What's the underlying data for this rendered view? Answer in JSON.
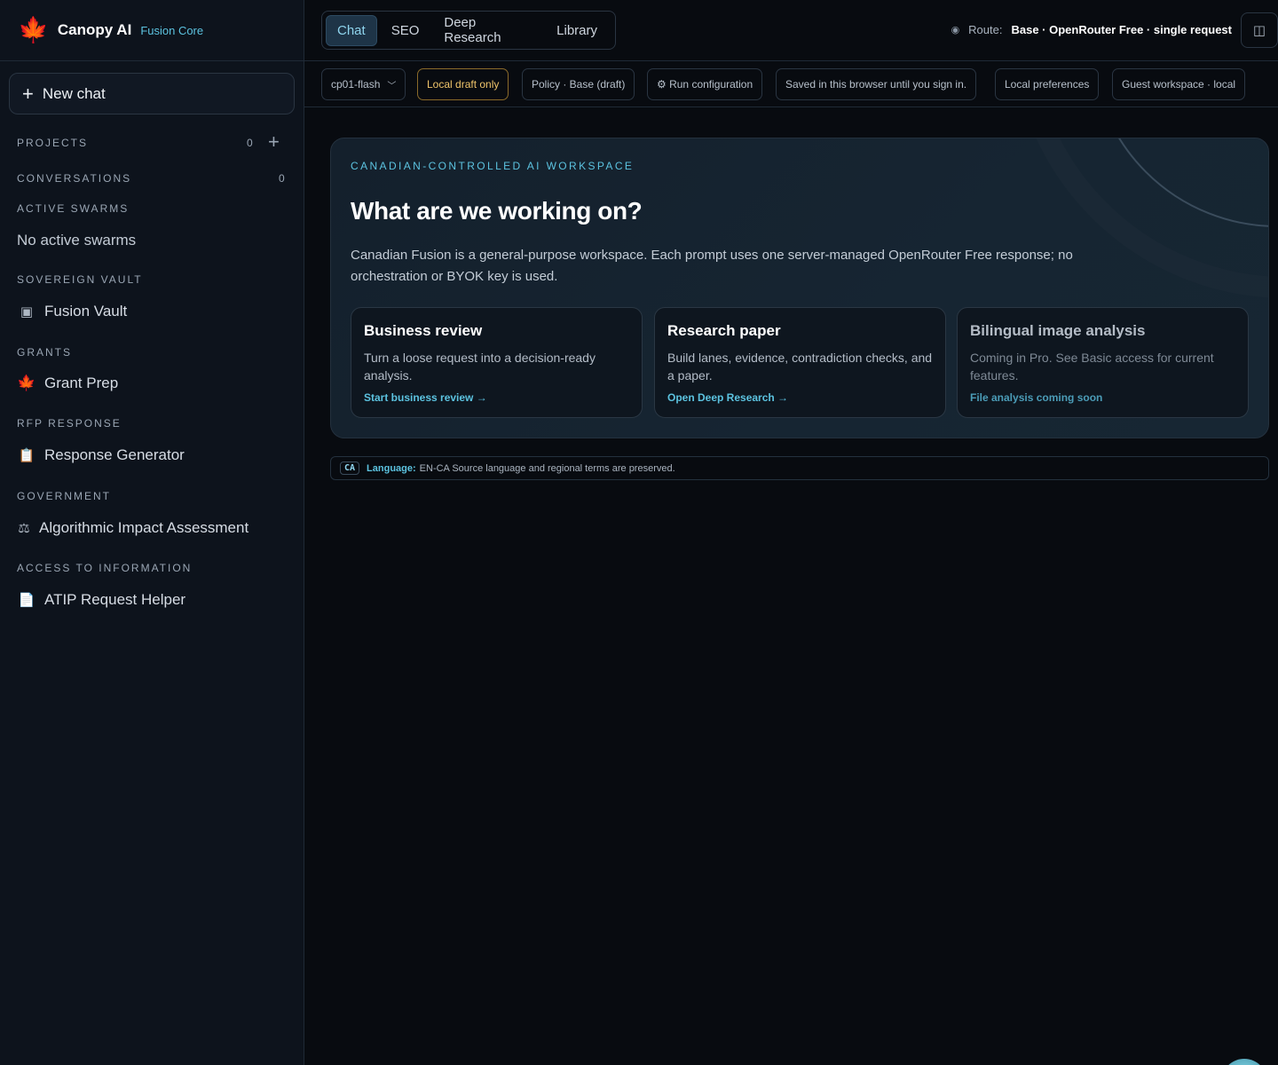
{
  "brand": {
    "name": "Canopy AI",
    "subtitle": "Fusion Core"
  },
  "sidebar": {
    "new_chat": "New chat",
    "projects": {
      "label": "PROJECTS",
      "count": "0"
    },
    "conversations": {
      "label": "CONVERSATIONS",
      "count": "0"
    },
    "active_swarms": {
      "label": "ACTIVE SWARMS",
      "empty": "No active swarms"
    },
    "sovereign_vault": {
      "label": "SOVEREIGN VAULT",
      "item": "Fusion Vault"
    },
    "grants": {
      "label": "GRANTS",
      "item": "Grant Prep"
    },
    "rfp": {
      "label": "RFP RESPONSE",
      "item": "Response Generator"
    },
    "government": {
      "label": "GOVERNMENT",
      "item": "Algorithmic Impact Assessment"
    },
    "ati": {
      "label": "ACCESS TO INFORMATION",
      "item": "ATIP Request Helper"
    }
  },
  "tabs": [
    "Chat",
    "SEO",
    "Deep Research",
    "Library"
  ],
  "route": {
    "label": "Route:",
    "value": "Base · OpenRouter Free · single request"
  },
  "chips": {
    "model": "cp01-flash",
    "draft": "Local draft only",
    "policy": "Policy · Base (draft)",
    "run_config": "⚙ Run configuration",
    "saved": "Saved in this browser until you sign in.",
    "prefs": "Local preferences",
    "workspace": "Guest workspace · local"
  },
  "hero": {
    "eyebrow": "CANADIAN-CONTROLLED AI WORKSPACE",
    "title": "What are we working on?",
    "description": "Canadian Fusion is a general-purpose workspace. Each prompt uses one server-managed OpenRouter Free response; no orchestration or BYOK key is used."
  },
  "cards": [
    {
      "title": "Business review",
      "desc": "Turn a loose request into a decision-ready analysis.",
      "link": "Start business review →"
    },
    {
      "title": "Research paper",
      "desc": "Build lanes, evidence, contradiction checks, and a paper.",
      "link": "Open Deep Research →"
    },
    {
      "title": "Bilingual image analysis",
      "desc": "Coming in Pro. See Basic access for current features.",
      "link": "File analysis coming soon"
    }
  ],
  "language": {
    "badge": "CA",
    "label": "Language:",
    "text": "EN-CA Source language and regional terms are preserved."
  },
  "colors": {
    "accent": "#5cc3e0",
    "warn": "#f0c46a",
    "brand_leaf": "#e3462b",
    "bg": "#080b10"
  }
}
